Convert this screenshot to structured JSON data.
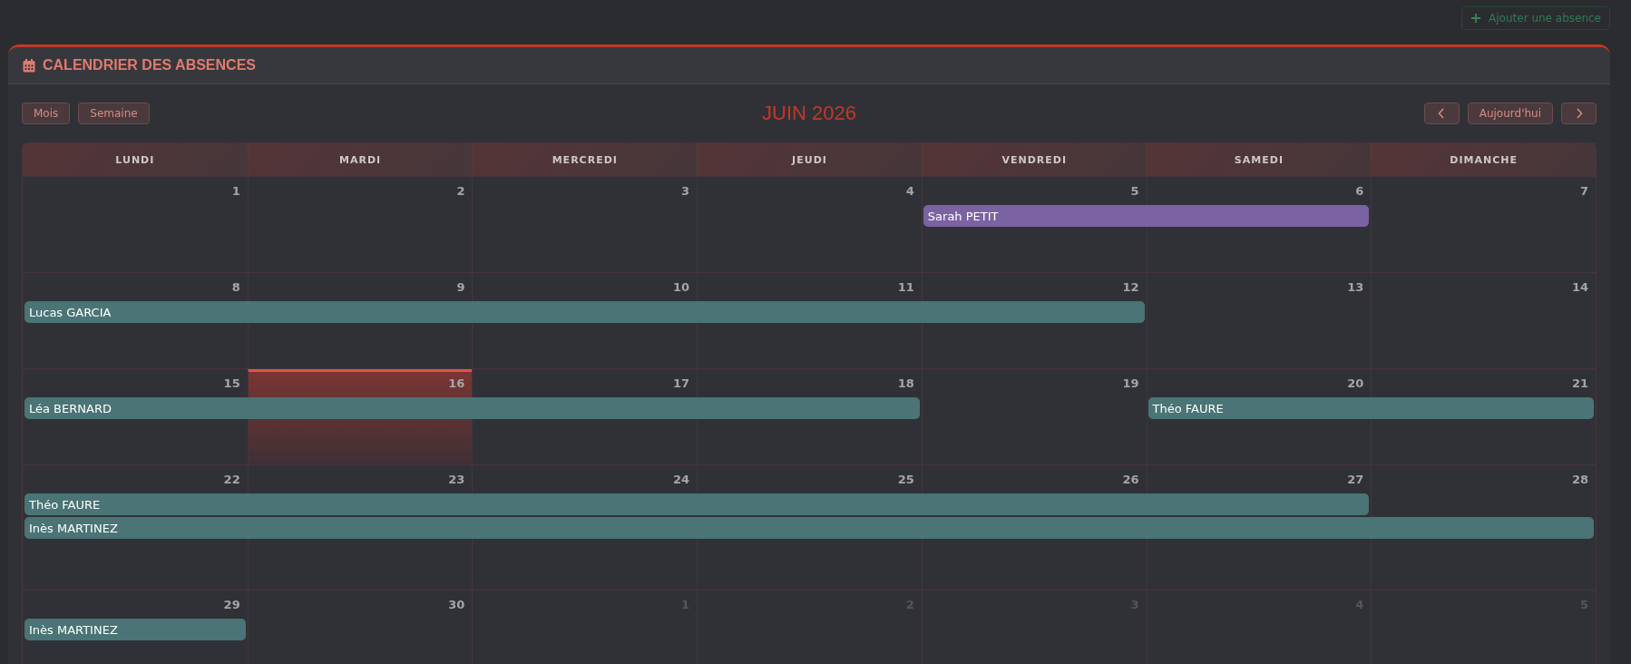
{
  "top_button": {
    "label": "Ajouter une absence"
  },
  "card": {
    "title": "CALENDRIER DES ABSENCES"
  },
  "view_buttons": [
    {
      "label": "Mois"
    },
    {
      "label": "Semaine"
    }
  ],
  "month_title": "JUIN 2026",
  "nav": {
    "today_label": "Aujourd'hui"
  },
  "weekdays": [
    "LUNDI",
    "MARDI",
    "MERCREDI",
    "JEUDI",
    "VENDREDI",
    "SAMEDI",
    "DIMANCHE"
  ],
  "weeks": [
    {
      "days": [
        {
          "number": "1",
          "other_month": false,
          "today": false
        },
        {
          "number": "2",
          "other_month": false,
          "today": false
        },
        {
          "number": "3",
          "other_month": false,
          "today": false
        },
        {
          "number": "4",
          "other_month": false,
          "today": false
        },
        {
          "number": "5",
          "other_month": false,
          "today": false
        },
        {
          "number": "6",
          "other_month": false,
          "today": false
        },
        {
          "number": "7",
          "other_month": false,
          "today": false
        }
      ],
      "events": [
        {
          "name": "Sarah PETIT",
          "color": "#7b62a3"
        }
      ]
    },
    {
      "days": [
        {
          "number": "8",
          "other_month": false,
          "today": false
        },
        {
          "number": "9",
          "other_month": false,
          "today": false
        },
        {
          "number": "10",
          "other_month": false,
          "today": false
        },
        {
          "number": "11",
          "other_month": false,
          "today": false
        },
        {
          "number": "12",
          "other_month": false,
          "today": false
        },
        {
          "number": "13",
          "other_month": false,
          "today": false
        },
        {
          "number": "14",
          "other_month": false,
          "today": false
        }
      ],
      "events": [
        {
          "name": "Lucas GARCIA",
          "color": "#4a7475"
        }
      ]
    },
    {
      "days": [
        {
          "number": "15",
          "other_month": false,
          "today": false
        },
        {
          "number": "16",
          "other_month": false,
          "today": true
        },
        {
          "number": "17",
          "other_month": false,
          "today": false
        },
        {
          "number": "18",
          "other_month": false,
          "today": false
        },
        {
          "number": "19",
          "other_month": false,
          "today": false
        },
        {
          "number": "20",
          "other_month": false,
          "today": false
        },
        {
          "number": "21",
          "other_month": false,
          "today": false
        }
      ],
      "events": [
        {
          "name": "Léa BERNARD",
          "color": "#4a7475"
        },
        {
          "name": "Théo FAURE",
          "color": "#4a7475"
        }
      ]
    },
    {
      "days": [
        {
          "number": "22",
          "other_month": false,
          "today": false
        },
        {
          "number": "23",
          "other_month": false,
          "today": false
        },
        {
          "number": "24",
          "other_month": false,
          "today": false
        },
        {
          "number": "25",
          "other_month": false,
          "today": false
        },
        {
          "number": "26",
          "other_month": false,
          "today": false
        },
        {
          "number": "27",
          "other_month": false,
          "today": false
        },
        {
          "number": "28",
          "other_month": false,
          "today": false
        }
      ],
      "events": [
        {
          "name": "Théo FAURE",
          "color": "#4a7475"
        },
        {
          "name": "Inès MARTINEZ",
          "color": "#4a7475"
        }
      ]
    },
    {
      "days": [
        {
          "number": "29",
          "other_month": false,
          "today": false
        },
        {
          "number": "30",
          "other_month": false,
          "today": false
        },
        {
          "number": "1",
          "other_month": true,
          "today": false
        },
        {
          "number": "2",
          "other_month": true,
          "today": false
        },
        {
          "number": "3",
          "other_month": true,
          "today": false
        },
        {
          "number": "4",
          "other_month": true,
          "today": false
        },
        {
          "number": "5",
          "other_month": true,
          "today": false
        }
      ],
      "events": [
        {
          "name": "Inès MARTINEZ",
          "color": "#4a7475"
        }
      ]
    }
  ]
}
